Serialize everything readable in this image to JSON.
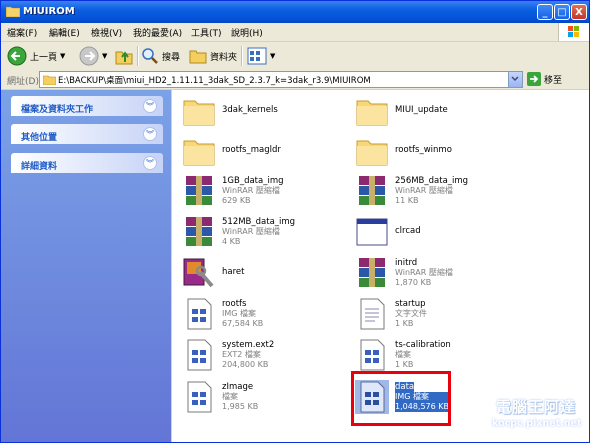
{
  "window": {
    "title": "MIUIROM",
    "minimize": "_",
    "maximize": "□",
    "close": "X"
  },
  "menu": {
    "items": [
      "檔案(F)",
      "編輯(E)",
      "檢視(V)",
      "我的最愛(A)",
      "工具(T)",
      "說明(H)"
    ]
  },
  "toolbar": {
    "back_label": "上一頁",
    "search_label": "搜尋",
    "folders_label": "資料夾"
  },
  "address": {
    "label": "網址(D)",
    "path": "E:\\BACKUP\\桌面\\miui_HD2_1.11.11_3dak_SD_2.3.7_k=3dak_r3.9\\MIUIROM",
    "go_label": "移至"
  },
  "sidebar": {
    "panels": [
      {
        "title": "檔案及資料夾工作"
      },
      {
        "title": "其他位置"
      },
      {
        "title": "詳細資料"
      }
    ]
  },
  "files": [
    {
      "name": "3dak_kernels",
      "type": "folder"
    },
    {
      "name": "MIUI_update",
      "type": "folder"
    },
    {
      "name": "rootfs_magldr",
      "type": "folder"
    },
    {
      "name": "rootfs_winmo",
      "type": "folder"
    },
    {
      "name": "1GB_data_img",
      "type": "rar",
      "desc": "WinRAR 壓縮檔",
      "size": "629 KB"
    },
    {
      "name": "256MB_data_img",
      "type": "rar",
      "desc": "WinRAR 壓縮檔",
      "size": "11 KB"
    },
    {
      "name": "512MB_data_img",
      "type": "rar",
      "desc": "WinRAR 壓縮檔",
      "size": "4 KB"
    },
    {
      "name": "clrcad",
      "type": "app"
    },
    {
      "name": "haret",
      "type": "haret"
    },
    {
      "name": "initrd",
      "type": "rar",
      "desc": "WinRAR 壓縮檔",
      "size": "1,870 KB"
    },
    {
      "name": "rootfs",
      "type": "img",
      "desc": "IMG 檔案",
      "size": "67,584 KB"
    },
    {
      "name": "startup",
      "type": "txt",
      "desc": "文字文件",
      "size": "1 KB"
    },
    {
      "name": "system.ext2",
      "type": "img",
      "desc": "EXT2 檔案",
      "size": "204,800 KB"
    },
    {
      "name": "ts-calibration",
      "type": "img",
      "desc": "檔案",
      "size": "1 KB"
    },
    {
      "name": "zImage",
      "type": "img",
      "desc": "檔案",
      "size": "1,985 KB"
    },
    {
      "name": "data",
      "type": "img",
      "desc": "IMG 檔案",
      "size": "1,048,576 KB"
    }
  ],
  "watermark": {
    "text": "電腦王阿達",
    "url": "kocpc.pixnet.net"
  }
}
